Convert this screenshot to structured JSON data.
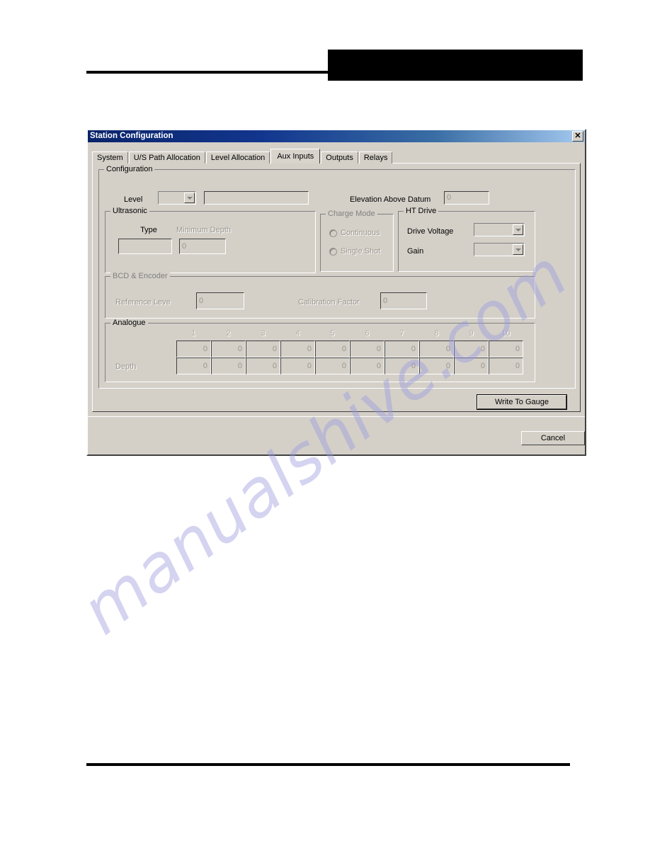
{
  "page": {
    "header_redaction": "",
    "footer_text": ""
  },
  "watermark": {
    "text": "manualshive.com"
  },
  "dialog": {
    "title": "Station Configuration",
    "close_icon": "close-icon",
    "tabs": [
      {
        "label": "System",
        "active": false
      },
      {
        "label": "U/S Path Allocation",
        "active": false
      },
      {
        "label": "Level Allocation",
        "active": false
      },
      {
        "label": "Aux Inputs",
        "active": true
      },
      {
        "label": "Outputs",
        "active": false
      },
      {
        "label": "Relays",
        "active": false
      }
    ],
    "buttons": {
      "write_to_gauge": "Write To Gauge",
      "cancel": "Cancel"
    }
  },
  "configuration": {
    "title": "Configuration",
    "level_label": "Level",
    "level_combo_value": "",
    "level_text_value": "",
    "elevation_label": "Elevation Above Datum",
    "elevation_value": "0"
  },
  "ultrasonic": {
    "title": "Ultrasonic",
    "type_label": "Type",
    "type_value": "",
    "minimum_depth_label": "Minimum Depth",
    "minimum_depth_value": "0"
  },
  "charge_mode": {
    "title": "Charge Mode",
    "options": [
      {
        "label": "Continuous",
        "selected": false
      },
      {
        "label": "Single Shot",
        "selected": false
      }
    ]
  },
  "ht_drive": {
    "title": "HT Drive",
    "drive_voltage_label": "Drive Voltage",
    "drive_voltage_value": "",
    "gain_label": "Gain",
    "gain_value": ""
  },
  "bcd_encoder": {
    "title": "BCD & Encoder",
    "reference_level_label": "Reference Leve",
    "reference_level_value": "0",
    "calibration_factor_label": "Calibration Factor",
    "calibration_factor_value": "0"
  },
  "analogue": {
    "title": "Analogue",
    "columns": [
      "1",
      "2",
      "3",
      "4",
      "5",
      "6",
      "7",
      "8",
      "9",
      "10"
    ],
    "rows": [
      {
        "label": "",
        "values": [
          "0",
          "0",
          "0",
          "0",
          "0",
          "0",
          "0",
          "0",
          "0",
          "0"
        ]
      },
      {
        "label": "Depth",
        "values": [
          "0",
          "0",
          "0",
          "0",
          "0",
          "0",
          "0",
          "0",
          "0",
          "0"
        ]
      }
    ]
  },
  "colors": {
    "dialog_face": "#d4d0c8",
    "titlebar_dark": "#0a246a",
    "titlebar_light": "#a6caf0",
    "disabled_text": "#9a968e",
    "watermark": "#9a9ae0"
  }
}
